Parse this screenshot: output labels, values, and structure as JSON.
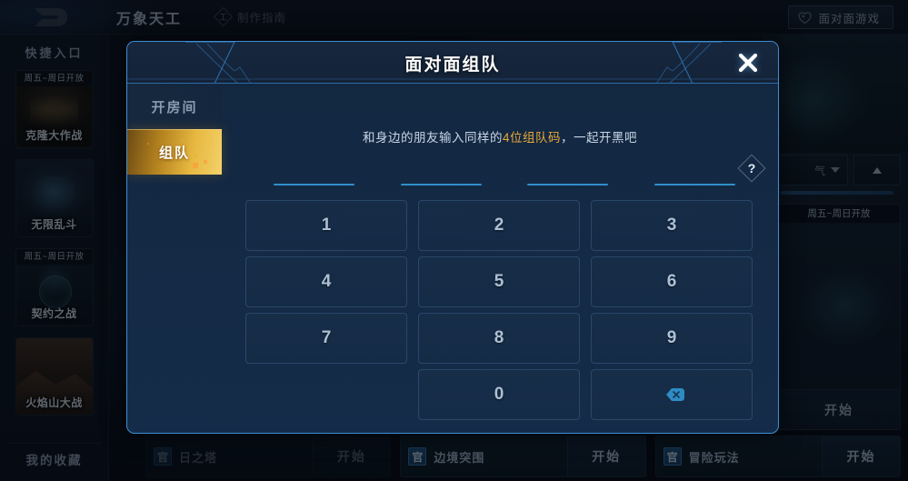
{
  "topbar": {
    "logo_icon": "game-logo-icon",
    "title": "万象天工",
    "guide_icon": "guide-diamond-icon",
    "guide_label": "制作指南",
    "cta_icon": "heart-shield-icon",
    "cta_label": "面对面游戏"
  },
  "sidebar": {
    "header": "快捷入口",
    "cards": [
      {
        "name": "克隆大作战",
        "badge": "周五~周日开放",
        "art": "art-clone"
      },
      {
        "name": "无限乱斗",
        "badge": "",
        "art": "art-infinite"
      },
      {
        "name": "契约之战",
        "badge": "周五~周日开放",
        "art": "art-contract"
      },
      {
        "name": "火焰山大战",
        "badge": "",
        "art": "art-flame"
      }
    ],
    "favorites_label": "我的收藏"
  },
  "right_rail": {
    "select_value": "气",
    "select_chevron_icon": "chevron-down-icon",
    "collapse_icon": "chevron-up-icon",
    "card": {
      "badge": "周五~周日开放",
      "start_label": "开始"
    }
  },
  "bottom_cards": [
    {
      "badge": "官",
      "name": "日之塔",
      "start_label": "开始",
      "dim": true
    },
    {
      "badge": "官",
      "name": "边境突围",
      "start_label": "开始",
      "dim": false
    },
    {
      "badge": "官",
      "name": "冒险玩法",
      "start_label": "开始",
      "dim": false
    }
  ],
  "modal": {
    "title": "面对面组队",
    "close_icon": "close-icon",
    "tabs": [
      {
        "label": "开房间",
        "active": false
      },
      {
        "label": "组队",
        "active": true
      }
    ],
    "hint_prefix": "和身边的朋友输入同样的",
    "hint_highlight": "4位组队码",
    "hint_suffix": "，一起开黑吧",
    "code_slots": [
      "",
      "",
      "",
      ""
    ],
    "help_icon": "help-diamond-icon",
    "help_glyph": "?",
    "keypad": [
      {
        "label": "1",
        "type": "digit"
      },
      {
        "label": "2",
        "type": "digit"
      },
      {
        "label": "3",
        "type": "digit"
      },
      {
        "label": "4",
        "type": "digit"
      },
      {
        "label": "5",
        "type": "digit"
      },
      {
        "label": "6",
        "type": "digit"
      },
      {
        "label": "7",
        "type": "digit"
      },
      {
        "label": "8",
        "type": "digit"
      },
      {
        "label": "9",
        "type": "digit"
      },
      {
        "label": "",
        "type": "blank"
      },
      {
        "label": "0",
        "type": "digit"
      },
      {
        "label": "",
        "type": "backspace"
      }
    ]
  },
  "colors": {
    "modal_border": "#3d8ed6",
    "accent_gold": "#e8a93a",
    "input_underline": "#2f8fcb",
    "backspace_blue": "#2e8bc4"
  }
}
